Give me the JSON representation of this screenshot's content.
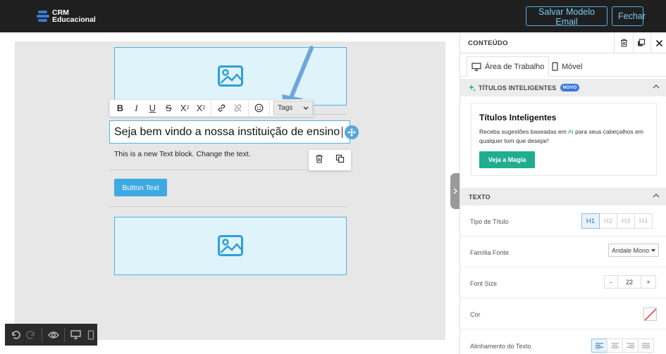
{
  "brand": {
    "line1": "CRM",
    "line2": "Educacional",
    "color": "#3b7bd6"
  },
  "topbar": {
    "save_label": "Salvar Modelo Email",
    "close_label": "Fechar"
  },
  "editor": {
    "toolbar": {
      "buttons": [
        "bold-icon",
        "italic-icon",
        "underline-icon",
        "strikethrough-icon",
        "superscript-icon",
        "subscript-icon",
        "link-icon",
        "unlink-icon",
        "emoji-icon"
      ],
      "tags_label": "Tags"
    },
    "heading_text": "Seja bem vindo a nossa instituição de ensino",
    "paragraph_text": "This is a new Text block. Change the text.",
    "button_text": "Button Text"
  },
  "panel": {
    "title": "CONTEÚDO",
    "tabs": [
      {
        "label": "Área de Trabalho",
        "icon": "desktop-icon",
        "active": true
      },
      {
        "label": "Móvel",
        "icon": "mobile-icon",
        "active": false
      }
    ],
    "smart_titles": {
      "section_label": "TÍTULOS INTELIGENTES",
      "badge": "NOVO",
      "card_title": "Títulos Inteligentes",
      "desc_before": "Receba sugestões baseadas em ",
      "desc_ai": "AI",
      "desc_after": " para seus cabeçalhos em qualquer tom que desejar!",
      "button": "Veja a Magia"
    },
    "text_section": {
      "label": "TEXTO",
      "heading_type_label": "Tipo de Título",
      "heading_types": [
        "H1",
        "H2",
        "H3",
        "H4"
      ],
      "heading_type_selected": "H1",
      "font_family_label": "Família Fonte",
      "font_family_value": "Andale Mono",
      "font_size_label": "Font Size",
      "font_size_minus": "-",
      "font_size_value": "22",
      "font_size_plus": "+",
      "color_label": "Cor",
      "align_label": "Alinhamento do Texto"
    }
  },
  "colors": {
    "accent": "#4fb3e6",
    "cta": "#3fa9e3",
    "magic": "#1fae8f",
    "topbar": "#1f1f1f"
  }
}
